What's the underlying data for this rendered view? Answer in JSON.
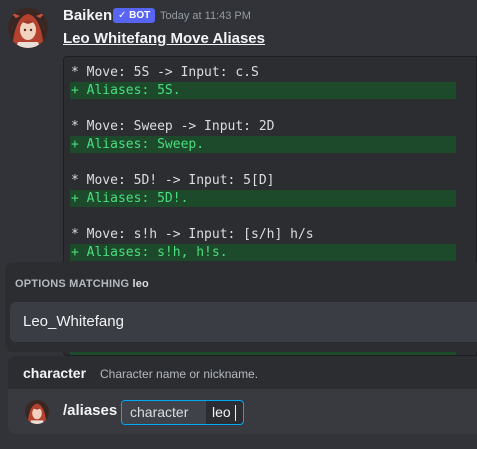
{
  "message": {
    "author": "Baiken",
    "bot_badge": "✓ BOT",
    "timestamp": "Today at 11:43 PM",
    "title": "Leo Whitefang Move Aliases",
    "code_lines": [
      {
        "text": "* Move: 5S -> Input: c.S",
        "added": false
      },
      {
        "text": "+ Aliases: 5S.",
        "added": true
      },
      {
        "text": "",
        "added": false
      },
      {
        "text": "* Move: Sweep -> Input: 2D",
        "added": false
      },
      {
        "text": "+ Aliases: Sweep.",
        "added": true
      },
      {
        "text": "",
        "added": false
      },
      {
        "text": "* Move: 5D! -> Input: 5[D]",
        "added": false
      },
      {
        "text": "+ Aliases: 5D!.",
        "added": true
      },
      {
        "text": "",
        "added": false
      },
      {
        "text": "* Move: s!h -> Input: [s/h] h/s",
        "added": false
      },
      {
        "text": "+ Aliases: s!h, h!s.",
        "added": true
      }
    ]
  },
  "autocomplete": {
    "header_prefix": "OPTIONS MATCHING",
    "query": "leo",
    "options": [
      "Leo_Whitefang"
    ]
  },
  "command_hint": {
    "option_name": "character",
    "option_description": "Character name or nickname."
  },
  "input": {
    "command": "/aliases",
    "param_name": "character",
    "param_value": "leo"
  },
  "colors": {
    "accent": "#5865f2",
    "diff_added_bg": "#1c4a2a",
    "diff_added_text": "#4ade80",
    "focus_border": "#00a8fc"
  },
  "icons": {
    "avatar": "baiken-avatar-icon",
    "small_avatar": "baiken-small-avatar-icon"
  }
}
